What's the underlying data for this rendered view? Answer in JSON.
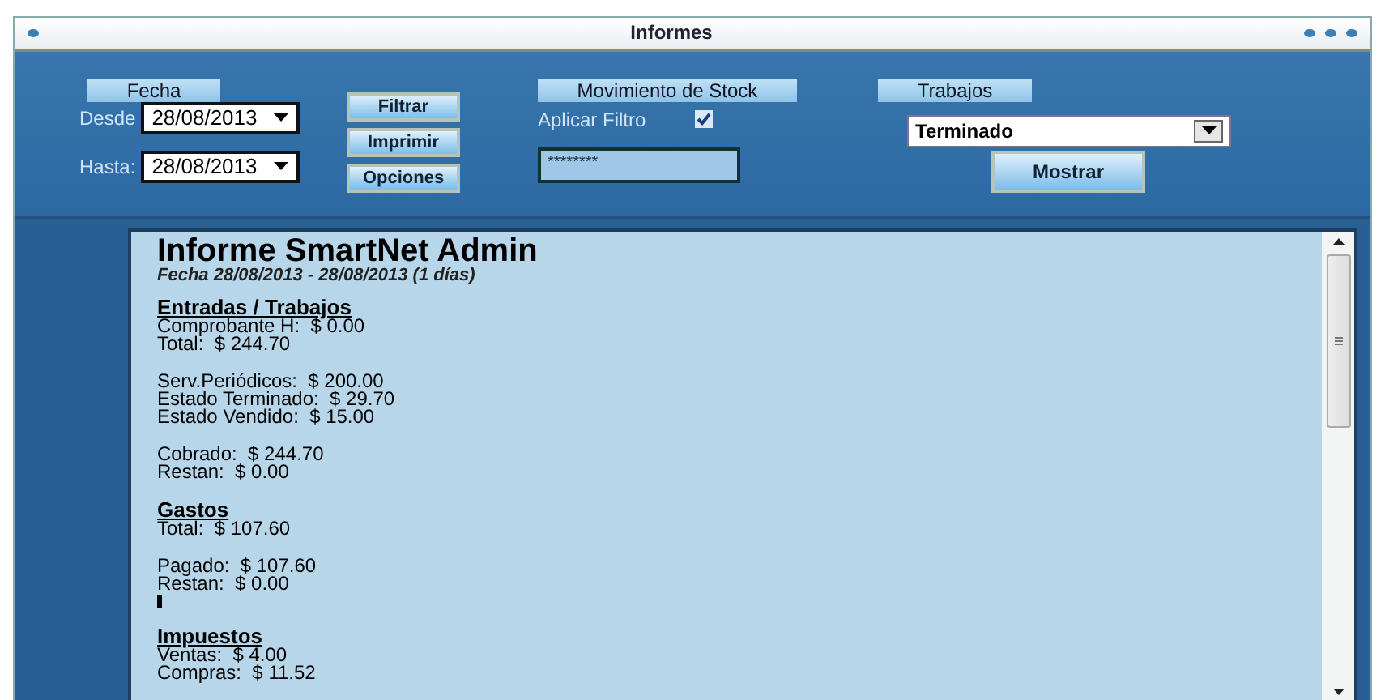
{
  "window": {
    "title": "Informes"
  },
  "fecha": {
    "header": "Fecha",
    "desde_label": "Desde",
    "desde_value": "28/08/2013",
    "hasta_label": "Hasta:",
    "hasta_value": "28/08/2013"
  },
  "buttons": [
    "Filtrar",
    "Imprimir",
    "Opciones"
  ],
  "stock": {
    "header": "Movimiento de Stock",
    "filter_label": "Aplicar Filtro",
    "checked": true,
    "password_value": "********"
  },
  "trabajos": {
    "header": "Trabajos",
    "selected_value": "Terminado",
    "button": "Mostrar"
  },
  "report": {
    "title": "Informe SmartNet Admin",
    "subtitle": "Fecha 28/08/2013 - 28/08/2013 (1 días)",
    "groups": [
      {
        "heading": "Entradas / Trabajos",
        "lines": [
          "Comprobante H:  $ 0.00",
          "Total:  $ 244.70"
        ]
      },
      {
        "lines": [
          "Serv.Periódicos:  $ 200.00",
          "Estado Terminado:  $ 29.70",
          "Estado Vendido:  $ 15.00"
        ]
      },
      {
        "lines": [
          "Cobrado:  $ 244.70",
          "Restan:  $ 0.00"
        ]
      },
      {
        "heading": "Gastos",
        "lines": [
          "Total:  $ 107.60"
        ]
      },
      {
        "lines": [
          "Pagado:  $ 107.60",
          "Restan:  $ 0.00"
        ],
        "cursor": true
      },
      {
        "heading": "Impuestos",
        "lines": [
          "Ventas:  $ 4.00",
          "Compras:  $ 11.52"
        ]
      }
    ]
  }
}
